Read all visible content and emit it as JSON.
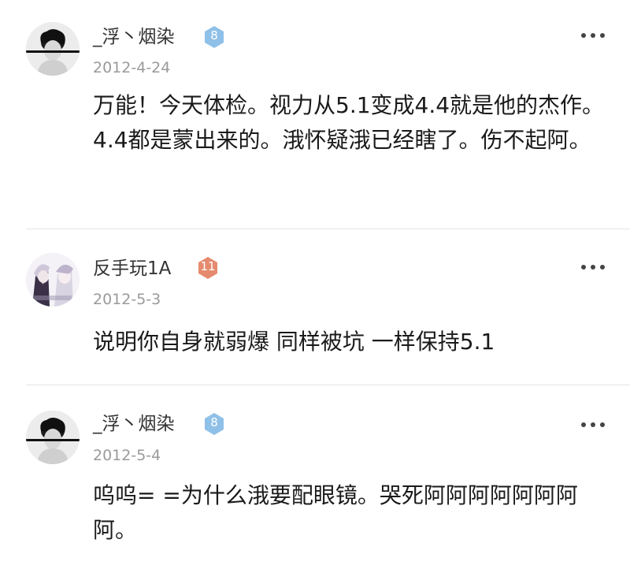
{
  "comments": [
    {
      "username": "_浮丶烟染",
      "level": "8",
      "date": "2012-4-24",
      "content": "万能！今天体检。视力从5.1变成4.4就是他的杰作。4.4都是蒙出来的。涐怀疑涐已经瞎了。伤不起阿。",
      "badge_color": "#8fc0e8"
    },
    {
      "username": "反手玩1A",
      "level": "11",
      "date": "2012-5-3",
      "content": "说明你自身就弱爆 同样被坑 一样保持5.1",
      "badge_color": "#e58a6e"
    },
    {
      "username": "_浮丶烟染",
      "level": "8",
      "date": "2012-5-4",
      "content": "呜呜= =为什么涐要配眼镜。哭死阿阿阿阿阿阿阿阿。",
      "badge_color": "#8fc0e8"
    }
  ],
  "icons": {
    "more": "more-dots-icon",
    "badge": "level-badge-icon"
  }
}
